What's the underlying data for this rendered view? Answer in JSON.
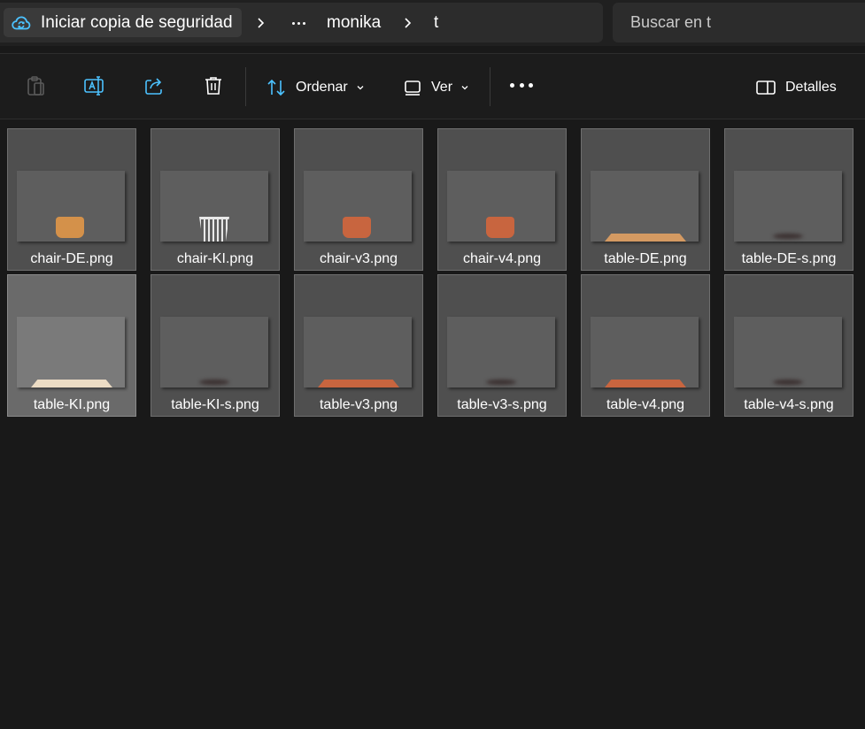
{
  "breadcrumb": {
    "backup_label": "Iniciar copia de seguridad",
    "items": [
      "monika",
      "t"
    ]
  },
  "search": {
    "placeholder": "Buscar en t"
  },
  "toolbar": {
    "sort_label": "Ordenar",
    "view_label": "Ver",
    "details_label": "Detalles"
  },
  "files": [
    {
      "name": "chair-DE.png",
      "preview": "chair",
      "color": "#d4914a"
    },
    {
      "name": "chair-KI.png",
      "preview": "chair-white",
      "color": "#e8e8e8"
    },
    {
      "name": "chair-v3.png",
      "preview": "chair",
      "color": "#c8653f"
    },
    {
      "name": "chair-v4.png",
      "preview": "chair",
      "color": "#c8653f"
    },
    {
      "name": "table-DE.png",
      "preview": "table",
      "color": "#d49a62"
    },
    {
      "name": "table-DE-s.png",
      "preview": "shadow",
      "color": "#3a2f2f"
    },
    {
      "name": "table-KI.png",
      "preview": "table",
      "color": "#ecdcc4"
    },
    {
      "name": "table-KI-s.png",
      "preview": "shadow",
      "color": "#3a2f2f"
    },
    {
      "name": "table-v3.png",
      "preview": "table",
      "color": "#c8653f"
    },
    {
      "name": "table-v3-s.png",
      "preview": "shadow",
      "color": "#3a2f2f"
    },
    {
      "name": "table-v4.png",
      "preview": "table",
      "color": "#c8653f"
    },
    {
      "name": "table-v4-s.png",
      "preview": "shadow",
      "color": "#3a2f2f"
    }
  ],
  "selected_file": "table-KI.png",
  "colors": {
    "accent": "#4cc2ff",
    "background": "#191919"
  }
}
